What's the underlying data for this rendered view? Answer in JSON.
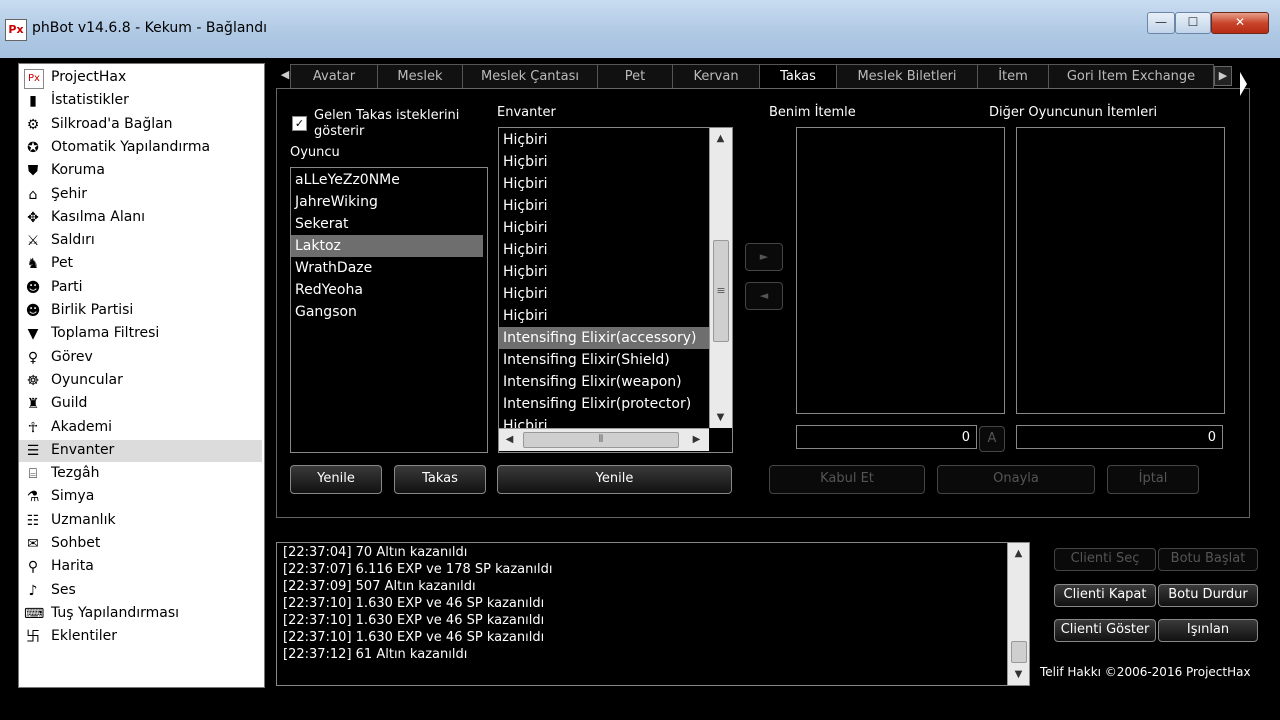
{
  "window": {
    "title": "phBot v14.6.8 - Kekum - Bağlandı",
    "icon_text": "Px",
    "controls": {
      "minimize": "—",
      "maximize": "☐",
      "close": "✕"
    }
  },
  "sidebar": {
    "items": [
      {
        "label": "ProjectHax",
        "icon": "px-logo-icon"
      },
      {
        "label": "İstatistikler",
        "icon": "statistics-icon"
      },
      {
        "label": "Silkroad'a Bağlan",
        "icon": "connect-icon"
      },
      {
        "label": "Otomatik Yapılandırma",
        "icon": "auto-config-icon"
      },
      {
        "label": "Koruma",
        "icon": "shield-icon"
      },
      {
        "label": "Şehir",
        "icon": "town-icon"
      },
      {
        "label": "Kasılma Alanı",
        "icon": "training-area-icon"
      },
      {
        "label": "Saldırı",
        "icon": "sword-icon"
      },
      {
        "label": "Pet",
        "icon": "pet-icon"
      },
      {
        "label": "Parti",
        "icon": "party-icon"
      },
      {
        "label": "Birlik Partisi",
        "icon": "union-party-icon"
      },
      {
        "label": "Toplama Filtresi",
        "icon": "pickup-filter-icon"
      },
      {
        "label": "Görev",
        "icon": "quest-icon"
      },
      {
        "label": "Oyuncular",
        "icon": "players-icon"
      },
      {
        "label": "Guild",
        "icon": "guild-icon"
      },
      {
        "label": "Akademi",
        "icon": "academy-icon"
      },
      {
        "label": "Envanter",
        "icon": "inventory-icon"
      },
      {
        "label": "Tezgâh",
        "icon": "stall-icon"
      },
      {
        "label": "Simya",
        "icon": "alchemy-icon"
      },
      {
        "label": "Uzmanlık",
        "icon": "mastery-icon"
      },
      {
        "label": "Sohbet",
        "icon": "chat-icon"
      },
      {
        "label": "Harita",
        "icon": "map-pin-icon"
      },
      {
        "label": "Ses",
        "icon": "bell-icon"
      },
      {
        "label": "Tuş Yapılandırması",
        "icon": "keyboard-icon"
      },
      {
        "label": "Eklentiler",
        "icon": "plugins-icon"
      }
    ],
    "selected_index": 16
  },
  "tabs": {
    "items": [
      "Avatar",
      "Meslek",
      "Meslek Çantası",
      "Pet",
      "Kervan",
      "Takas",
      "Meslek Biletleri",
      "İtem",
      "Gori Item Exchange"
    ],
    "active": "Takas",
    "nav_left": "◀",
    "nav_right": "▶"
  },
  "trade": {
    "accept_requests_label": "Gelen Takas isteklerini\ngösterir",
    "accept_requests_checked": "✓",
    "player_label": "Oyuncu",
    "players": [
      "aLLeYeZz0NMe",
      "JahreWiking",
      "Sekerat",
      "Laktoz",
      "WrathDaze",
      "RedYeoha",
      "Gangson"
    ],
    "selected_player": "Laktoz",
    "inventory_label": "Envanter",
    "inventory": [
      "Hiçbiri",
      "Hiçbiri",
      "Hiçbiri",
      "Hiçbiri",
      "Hiçbiri",
      "Hiçbiri",
      "Hiçbiri",
      "Hiçbiri",
      "Hiçbiri",
      "Intensifing Elixir(accessory)",
      "Intensifing Elixir(Shield)",
      "Intensifing Elixir(weapon)",
      "Intensifing Elixir(protector)",
      "Hiçbiri"
    ],
    "selected_inventory": "Intensifing Elixir(accessory)",
    "my_items_label": "Benim İtemle",
    "other_items_label": "Diğer Oyuncunun İtemleri",
    "add_arrow": "►",
    "remove_arrow": "◄",
    "my_gold": "0",
    "gold_button": "A",
    "other_gold": "0",
    "refresh_players": "Yenile",
    "trade_button": "Takas",
    "refresh_inventory": "Yenile",
    "accept": "Kabul Et",
    "confirm": "Onayla",
    "cancel": "İptal"
  },
  "log": {
    "lines": [
      "[22:37:04] 70 Altın kazanıldı",
      "[22:37:07] 6.116 EXP ve 178 SP kazanıldı",
      "[22:37:09] 507 Altın kazanıldı",
      "[22:37:10] 1.630 EXP ve 46 SP kazanıldı",
      "[22:37:10] 1.630 EXP ve 46 SP kazanıldı",
      "[22:37:10] 1.630 EXP ve 46 SP kazanıldı",
      "[22:37:12] 61 Altın kazanıldı"
    ]
  },
  "controls": {
    "select_client": "Clienti Seç",
    "start_bot": "Botu Başlat",
    "close_client": "Clienti Kapat",
    "stop_bot": "Botu Durdur",
    "show_client": "Clienti Göster",
    "teleport": "Işınlan"
  },
  "copyright": "Telif Hakkı ©2006-2016 ProjectHax",
  "scroll_glyphs": {
    "up": "▲",
    "down": "▼",
    "left": "◀",
    "right": "▶",
    "grip_v": "≡",
    "grip_h": "⦀"
  }
}
